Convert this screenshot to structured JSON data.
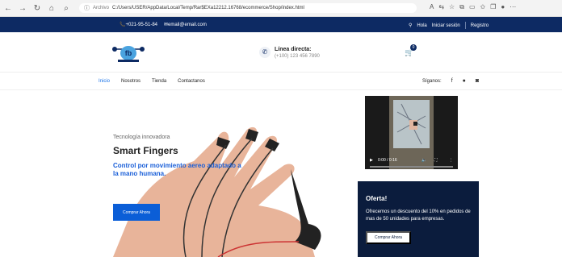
{
  "browser": {
    "address_label": "Archivo",
    "url": "C:/Users/USER/AppData/Local/Temp/Rar$EXa12212.16768/ecommerce/Shop/index.html"
  },
  "topbar": {
    "phone": "+021-95-51-84",
    "email": "email@email.com",
    "greeting": "Hola",
    "login": "Iniciar sesión",
    "register": "Registro"
  },
  "header": {
    "direct_title": "Línea directa:",
    "direct_number": "(+100) 123 456 7890",
    "cart_count": "0"
  },
  "menu": {
    "items": [
      "Inicio",
      "Nosotros",
      "Tienda",
      "Contactanos"
    ],
    "social_label": "Síganos:"
  },
  "hero": {
    "subtitle": "Tecnología innovadora",
    "title": "Smart Fingers",
    "description": "Control por movimiento aereo adaptado a la mano humana.",
    "button": "Comprar Ahora"
  },
  "video": {
    "time": "0:00 / 0:16"
  },
  "offer": {
    "title": "Oferta!",
    "description": "Ofrecemos un descuento del 10% en pedidos de mas de 50 unidades para empresas.",
    "button": "Comprar Ahora"
  },
  "colors": {
    "navy": "#0d2a63",
    "blue": "#0b5ed7",
    "link": "#1a73e8"
  }
}
